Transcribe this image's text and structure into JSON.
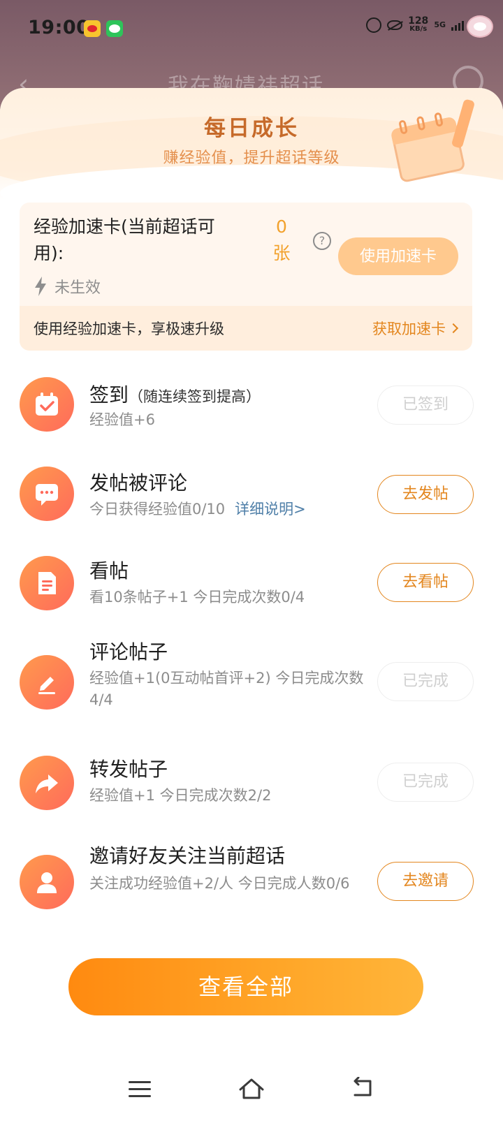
{
  "status_bar": {
    "time": "19:00",
    "net_speed": "128",
    "net_unit": "KB/s",
    "net_type": "5G"
  },
  "background_page": {
    "title": "我在鞠婧祎超话"
  },
  "sheet": {
    "title": "每日成长",
    "subtitle": "赚经验值，提升超话等级"
  },
  "speed_card": {
    "label": "经验加速卡(当前超话可用):",
    "count": "0",
    "count_unit": "张",
    "help": "?",
    "use_button": "使用加速卡",
    "status": "未生效",
    "footer_text": "使用经验加速卡，享极速升级",
    "get_link": "获取加速卡"
  },
  "tasks": [
    {
      "title": "签到",
      "hint": "（随连续签到提高）",
      "desc": "经验值+6",
      "button": "已签到",
      "icon": "calendar-check-icon"
    },
    {
      "title": "发帖被评论",
      "desc": "今日获得经验值0/10",
      "link": "详细说明>",
      "button": "去发帖",
      "icon": "chat-bubble-icon"
    },
    {
      "title": "看帖",
      "desc": "看10条帖子+1   今日完成次数0/4",
      "button": "去看帖",
      "icon": "document-icon"
    },
    {
      "title": "评论帖子",
      "desc": "经验值+1(0互动帖首评+2)   今日完成次数4/4",
      "button": "已完成",
      "icon": "edit-pen-icon"
    },
    {
      "title": "转发帖子",
      "desc": "经验值+1   今日完成次数2/2",
      "button": "已完成",
      "icon": "share-arrow-icon"
    },
    {
      "title": "邀请好友关注当前超话",
      "desc": "关注成功经验值+2/人   今日完成人数0/6",
      "button": "去邀请",
      "icon": "person-icon"
    }
  ],
  "view_all_button": "查看全部",
  "colors": {
    "accent": "#e3861e",
    "title_brown": "#c66a2a",
    "icon_gradient_start": "#ff9a4d",
    "icon_gradient_end": "#ff6b5b"
  }
}
